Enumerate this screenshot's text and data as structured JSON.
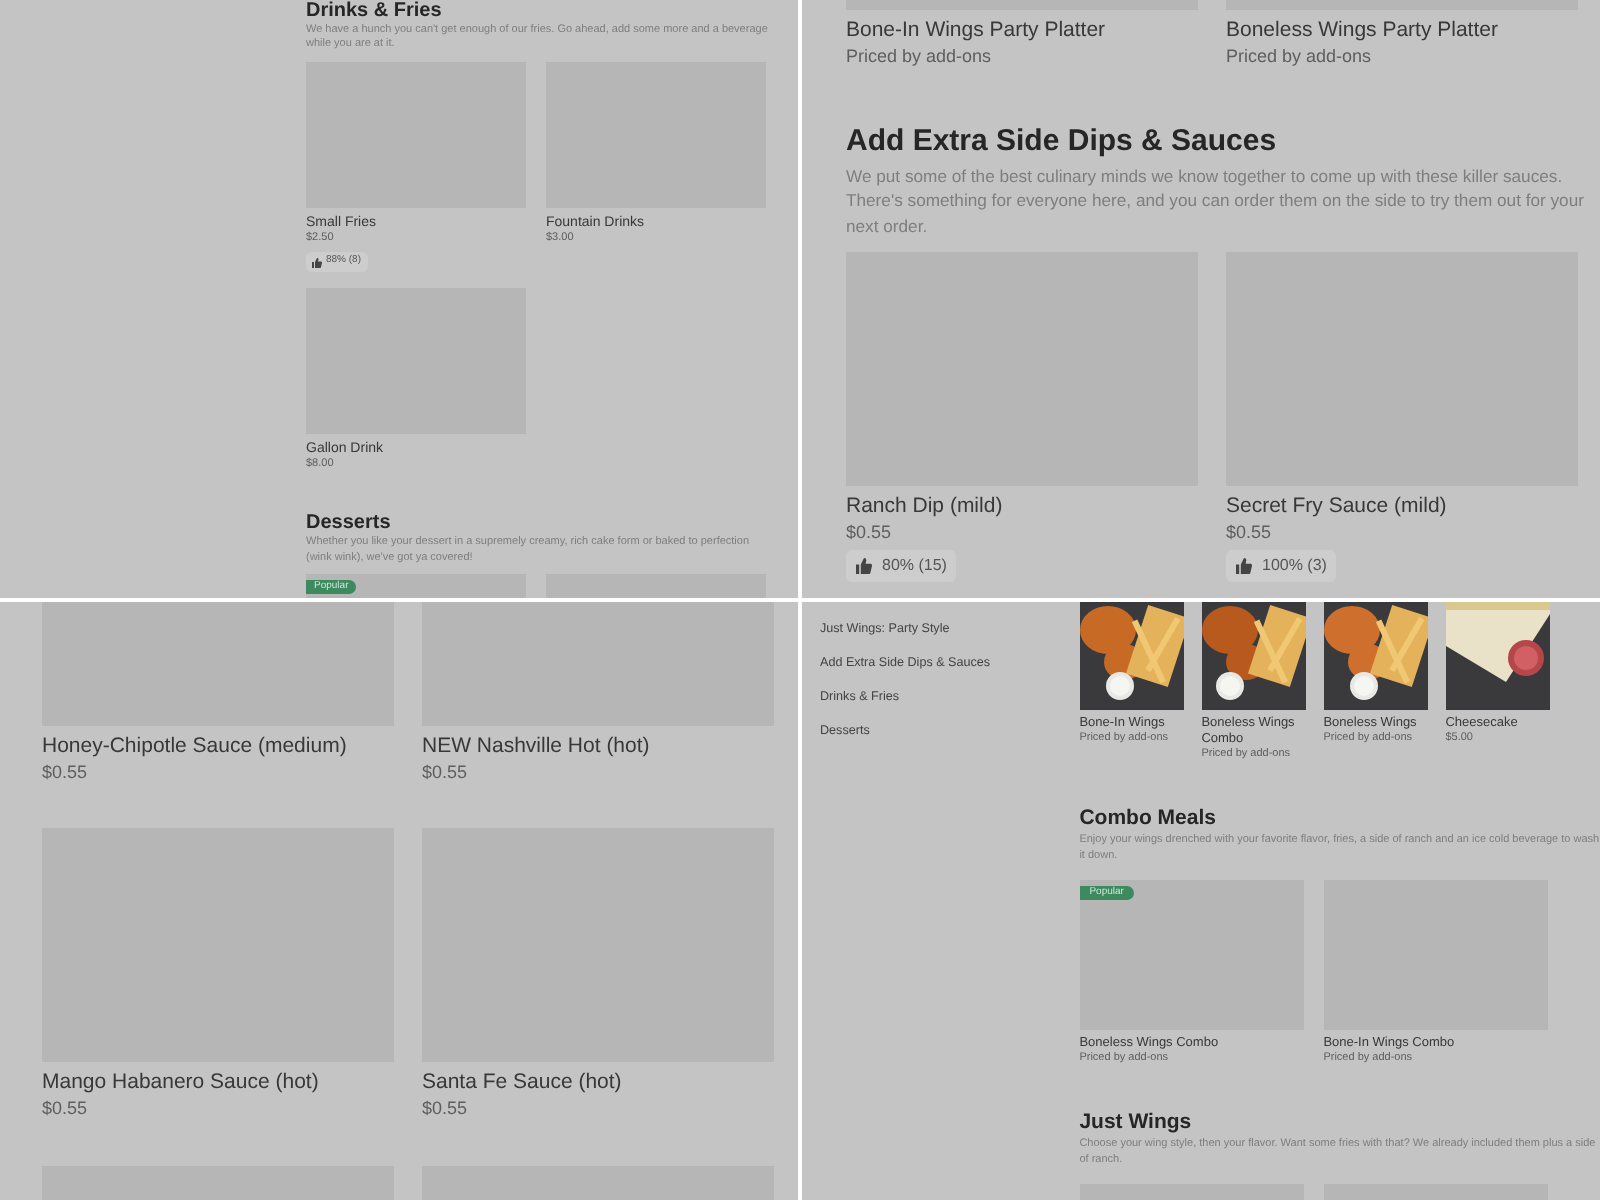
{
  "panels": [
    {
      "kind": "narrow",
      "sections": [
        {
          "heading": "Drinks & Fries",
          "description": "We have a hunch you can't get enough of our fries. Go ahead, add some more and a beverage while you are at it.",
          "items": [
            {
              "kind": "placeholder",
              "name": "Small Fries",
              "price": "$2.50",
              "rating": "88% (8)"
            },
            {
              "kind": "placeholder",
              "name": "Fountain Drinks",
              "price": "$3.00"
            },
            {
              "kind": "placeholder",
              "name": "Gallon Drink",
              "price": "$8.00"
            }
          ]
        },
        {
          "heading": "Desserts",
          "description": "Whether you like your dessert in a supremely creamy, rich cake form or baked to perfection (wink wink), we've got ya covered!",
          "items": [
            {
              "kind": "placeholder",
              "badge": "Popular"
            },
            {
              "kind": "placeholder"
            }
          ]
        }
      ]
    },
    {
      "kind": "wide",
      "sections": [
        {
          "items": [
            {
              "kind": "placeholder",
              "name": "Bone-In Wings Party Platter",
              "price": "Priced by add-ons"
            },
            {
              "kind": "placeholder",
              "name": "Boneless Wings Party Platter",
              "price": "Priced by add-ons"
            }
          ]
        },
        {
          "heading": "Add Extra Side Dips & Sauces",
          "description": "We put some of the best culinary minds we know together to come up with these killer sauces. There's something for everyone here, and you can order them on the side to try them out for your next order.",
          "items": [
            {
              "kind": "placeholder",
              "name": "Ranch Dip (mild)",
              "price": "$0.55",
              "rating": "80% (15)"
            },
            {
              "kind": "placeholder",
              "name": "Secret Fry Sauce (mild)",
              "price": "$0.55",
              "rating": "100% (3)"
            }
          ]
        }
      ]
    },
    {
      "kind": "wide",
      "sections": [
        {
          "items": [
            {
              "kind": "placeholder",
              "name": "Honey-Chipotle Sauce (medium)",
              "price": "$0.55"
            },
            {
              "kind": "placeholder",
              "name": "NEW Nashville Hot (hot)",
              "price": "$0.55"
            },
            {
              "kind": "placeholder",
              "name": "Mango Habanero Sauce (hot)",
              "price": "$0.55"
            },
            {
              "kind": "placeholder",
              "name": "Santa Fe Sauce (hot)",
              "price": "$0.55"
            },
            {
              "kind": "placeholder"
            },
            {
              "kind": "placeholder"
            }
          ]
        }
      ]
    },
    {
      "kind": "sidebar",
      "sidebar": [
        "Just Wings: Party Style",
        "Add Extra Side Dips & Sauces",
        "Drinks & Fries",
        "Desserts"
      ],
      "sections": [
        {
          "items": [
            {
              "kind": "picture",
              "name": "Bone-In Wings",
              "price": "Priced by add-ons"
            },
            {
              "kind": "picture",
              "name": "Boneless Wings Combo",
              "price": "Priced by add-ons"
            },
            {
              "kind": "picture",
              "name": "Boneless Wings",
              "price": "Priced by add-ons"
            },
            {
              "kind": "picture",
              "name": "Cheesecake",
              "price": "$5.00"
            }
          ]
        },
        {
          "heading": "Combo Meals",
          "description": "Enjoy your wings drenched with your favorite flavor, fries, a side of ranch and an ice cold beverage to wash it down.",
          "items": [
            {
              "kind": "placeholder",
              "badge": "Popular",
              "name": "Boneless Wings Combo",
              "price": "Priced by add-ons"
            },
            {
              "kind": "placeholder",
              "name": "Bone-In Wings Combo",
              "price": "Priced by add-ons"
            }
          ]
        },
        {
          "heading": "Just Wings",
          "description": "Choose your wing style, then your flavor. Want some fries with that? We already included them plus a side of ranch.",
          "items": [
            {
              "kind": "placeholder"
            },
            {
              "kind": "placeholder"
            }
          ]
        }
      ]
    }
  ]
}
